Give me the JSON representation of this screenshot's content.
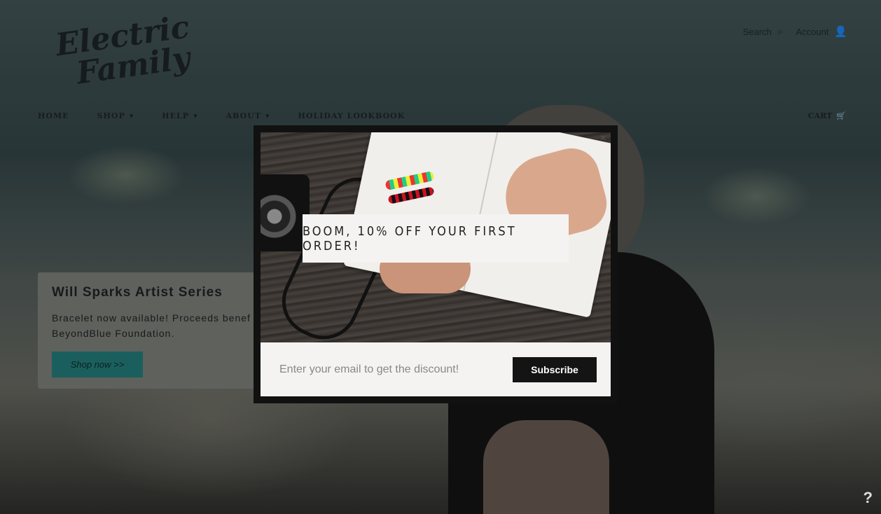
{
  "header": {
    "logo_line1": "Electric",
    "logo_line2": "Family",
    "search_label": "Search",
    "search_icon": "search-icon",
    "account_label": "Account",
    "account_icon": "user-icon",
    "cart_label": "CART",
    "cart_icon": "cart-icon"
  },
  "nav": {
    "items": [
      {
        "label": "HOME",
        "has_dropdown": false
      },
      {
        "label": "SHOP",
        "has_dropdown": true
      },
      {
        "label": "HELP",
        "has_dropdown": true
      },
      {
        "label": "ABOUT",
        "has_dropdown": true
      },
      {
        "label": "HOLIDAY LOOKBOOK",
        "has_dropdown": false
      }
    ],
    "chevron": "▾"
  },
  "promo": {
    "title": "Will Sparks Artist Series",
    "text_line1": "Bracelet now available! Proceeds benef",
    "text_line2": "BeyondBlue Foundation.",
    "button_label": "Shop now >>"
  },
  "modal": {
    "close_label": "×",
    "headline": "BOOM, 10% OFF YOUR FIRST ORDER!",
    "email_placeholder": "Enter your email to get the discount!",
    "email_value": "",
    "subscribe_label": "Subscribe"
  },
  "help": {
    "label": "?"
  },
  "colors": {
    "promo_button": "#1e6d6a",
    "subscribe_button": "#141414",
    "modal_bg": "#f5f3f1"
  }
}
